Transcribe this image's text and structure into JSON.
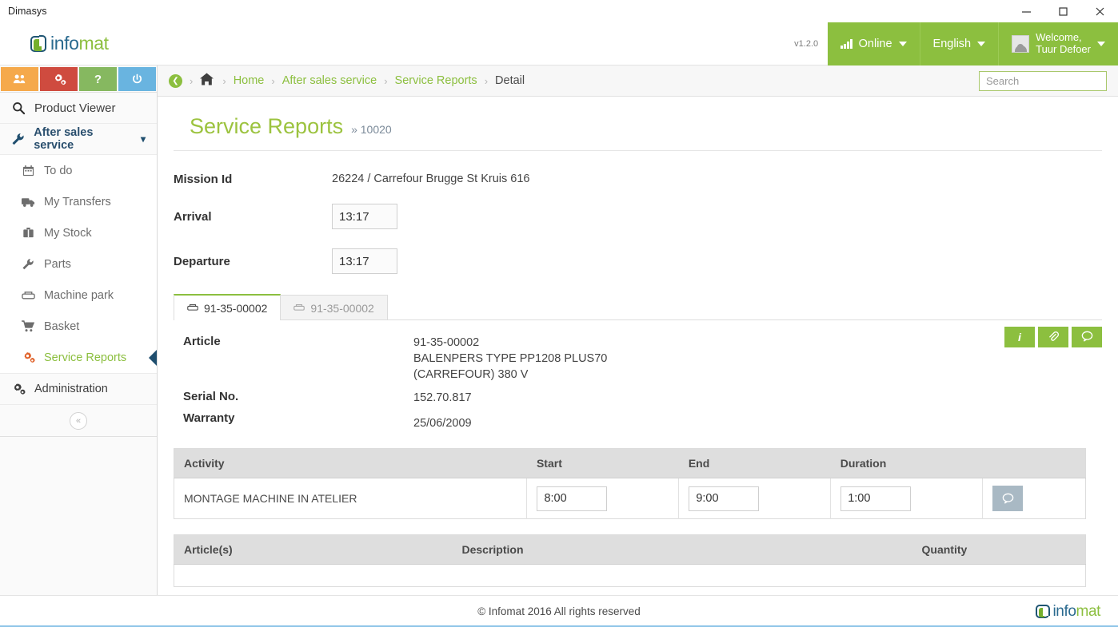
{
  "window": {
    "title": "Dimasys",
    "minimize": "–",
    "maximize": "□",
    "close": "✕"
  },
  "brand": {
    "name_part1": "info",
    "name_part2": "mat",
    "logo_icon": "infomat-logo-icon"
  },
  "header": {
    "version": "v1.2.0",
    "status_label": "Online",
    "status_icon": "signal-bars-icon",
    "language_label": "English",
    "welcome_line1": "Welcome,",
    "welcome_line2": "Tuur Defoer",
    "avatar_icon": "user-avatar-icon",
    "caret_icon": "chevron-down-icon"
  },
  "quickbar": {
    "buttons": [
      {
        "name": "users-button",
        "icon": "users-group-icon",
        "color": "#f5a94b"
      },
      {
        "name": "settings-button",
        "icon": "gears-icon",
        "color": "#cf4b3f"
      },
      {
        "name": "help-button",
        "icon": "question-mark-icon",
        "label": "?",
        "color": "#86b860"
      },
      {
        "name": "power-button",
        "icon": "power-icon",
        "color": "#69b4e0"
      }
    ]
  },
  "sidebar": {
    "top_items": [
      {
        "label": "Product Viewer",
        "icon": "magnifier-icon"
      },
      {
        "label": "After sales service",
        "icon": "wrench-icon",
        "expanded": true
      }
    ],
    "sub_items": [
      {
        "label": "To do",
        "icon": "calendar-icon"
      },
      {
        "label": "My Transfers",
        "icon": "truck-icon"
      },
      {
        "label": "My Stock",
        "icon": "briefcase-icon"
      },
      {
        "label": "Parts",
        "icon": "wrench-icon"
      },
      {
        "label": "Machine park",
        "icon": "machine-icon"
      },
      {
        "label": "Basket",
        "icon": "cart-icon"
      },
      {
        "label": "Service Reports",
        "icon": "gears-icon",
        "selected": true
      }
    ],
    "bottom_items": [
      {
        "label": "Administration",
        "icon": "gears-icon"
      }
    ],
    "collapse_label": "«"
  },
  "breadcrumb": {
    "back_icon": "back-arrow-icon",
    "home_icon": "home-icon",
    "separator": "›",
    "items": [
      {
        "label": "Home",
        "current": false
      },
      {
        "label": "After sales service",
        "current": false
      },
      {
        "label": "Service Reports",
        "current": false
      },
      {
        "label": "Detail",
        "current": true
      }
    ]
  },
  "search": {
    "placeholder": "Search",
    "value": "",
    "icon": "search-icon"
  },
  "page": {
    "title": "Service Reports",
    "subtitle": "» 10020"
  },
  "form": {
    "mission_id_label": "Mission Id",
    "mission_id_value": "26224 / Carrefour Brugge St Kruis 616",
    "arrival_label": "Arrival",
    "arrival_value": "13:17",
    "departure_label": "Departure",
    "departure_value": "13:17"
  },
  "tabs": [
    {
      "label": "91-35-00002",
      "icon": "machine-icon",
      "active": true
    },
    {
      "label": "91-35-00002",
      "icon": "machine-icon",
      "active": false
    }
  ],
  "article": {
    "article_label": "Article",
    "article_line1": "91-35-00002",
    "article_line2": "BALENPERS TYPE PP1208 PLUS70",
    "article_line3": "(CARREFOUR) 380 V",
    "serial_label": "Serial No.",
    "serial_value": "152.70.817",
    "warranty_label": "Warranty",
    "warranty_value": "25/06/2009"
  },
  "action_buttons": [
    {
      "name": "info-button",
      "icon": "info-icon",
      "glyph": "i"
    },
    {
      "name": "attachment-button",
      "icon": "paperclip-icon",
      "glyph": "📎"
    },
    {
      "name": "comment-button",
      "icon": "speech-bubble-icon",
      "glyph": "💬"
    }
  ],
  "activity_table": {
    "headers": [
      "Activity",
      "Start",
      "End",
      "Duration",
      ""
    ],
    "rows": [
      {
        "activity": "MONTAGE MACHINE IN ATELIER",
        "start": "8:00",
        "end": "9:00",
        "duration": "1:00",
        "comment_icon": "speech-bubble-icon"
      }
    ]
  },
  "articles_table": {
    "headers": [
      "Article(s)",
      "Description",
      "Quantity"
    ],
    "rows": []
  },
  "footer": {
    "copyright": "© Infomat 2016 All rights reserved",
    "logo_part1": "info",
    "logo_part2": "mat"
  },
  "colors": {
    "brand_green": "#8cbf3f",
    "brand_blue": "#2a6a8f",
    "title_green": "#9cc33f",
    "marker_blue": "#1f4e6e",
    "table_header_gray": "#dedede"
  }
}
